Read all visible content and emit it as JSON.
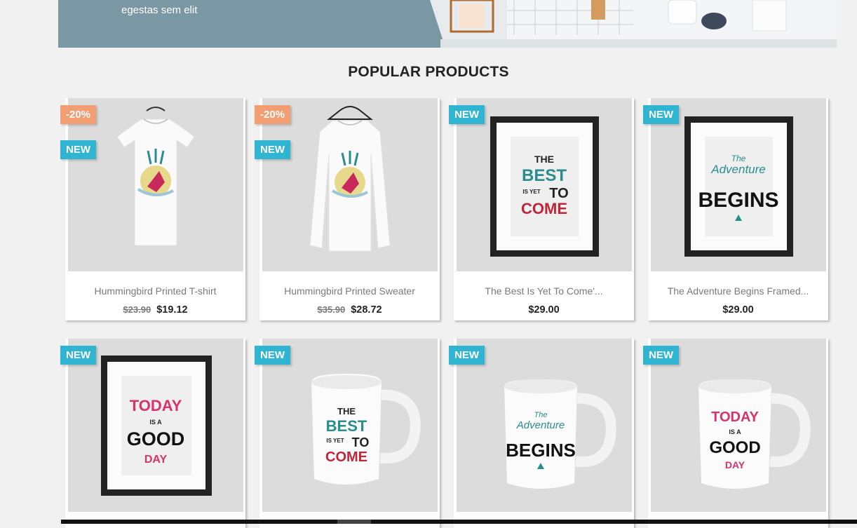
{
  "banner": {
    "text": "egestas sem elit",
    "colors": {
      "panel": "#7a98a4"
    }
  },
  "section": {
    "title": "POPULAR PRODUCTS"
  },
  "products": [
    {
      "name": "Hummingbird Printed T-shirt",
      "old_price": "$23.90",
      "price": "$19.12",
      "discount": "-20%",
      "flag": "NEW",
      "image": "tshirt"
    },
    {
      "name": "Hummingbird Printed Sweater",
      "old_price": "$35.90",
      "price": "$28.72",
      "discount": "-20%",
      "flag": "NEW",
      "image": "sweater"
    },
    {
      "name": "The Best Is Yet To Come'...",
      "price": "$29.00",
      "flag": "NEW",
      "image": "frame-best"
    },
    {
      "name": "The Adventure Begins Framed...",
      "price": "$29.00",
      "flag": "NEW",
      "image": "frame-adventure"
    },
    {
      "flag": "NEW",
      "image": "frame-today"
    },
    {
      "flag": "NEW",
      "image": "mug-best"
    },
    {
      "flag": "NEW",
      "image": "mug-adventure"
    },
    {
      "flag": "NEW",
      "image": "mug-today"
    }
  ],
  "artwork": {
    "best": {
      "l1": "THE",
      "l2": "BEST",
      "l3": "IS YET",
      "l4": "TO",
      "l5": "COME"
    },
    "adventure": {
      "l1": "The",
      "l2": "Adventure",
      "l3": "BEGINS"
    },
    "today": {
      "l1": "TODAY",
      "l2": "IS A",
      "l3": "GOOD",
      "l4": "DAY"
    }
  },
  "colors": {
    "flag_new": "#2fb5d2",
    "flag_discount": "#f39d72",
    "teal": "#2a8c8c",
    "red": "#c0263a",
    "pink": "#d6336c"
  }
}
